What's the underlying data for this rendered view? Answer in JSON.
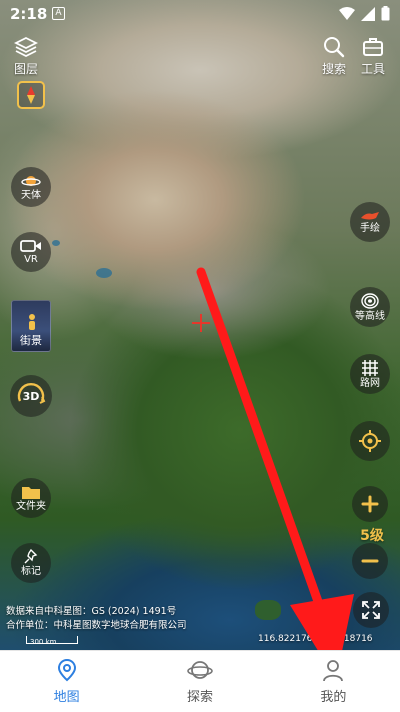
{
  "status_bar": {
    "time": "2:18",
    "notification": "A"
  },
  "top_left": {
    "layers_label": "图层"
  },
  "top_right": {
    "search_label": "搜索",
    "tools_label": "工具"
  },
  "left_tools": {
    "celestial_label": "天体",
    "vr_label": "VR",
    "street_label": "街景",
    "threed_label": "3D",
    "folder_label": "文件夹",
    "marker_label": "标记"
  },
  "right_tools": {
    "draw_label": "手绘",
    "contour_label": "等高线",
    "grid_label": "路网",
    "zoom_level": "5级"
  },
  "attribution": {
    "line1": "数据来自中科星图：GS (2024) 1491号",
    "line2": "合作单位：中科星图数字地球合肥有限公司"
  },
  "scale_label": "300 km",
  "coordinates": "116.82217634.66818716",
  "bottom_nav": {
    "map_label": "地图",
    "explore_label": "探索",
    "me_label": "我的"
  },
  "colors": {
    "accent": "#2d7fe0",
    "highlight": "#f2c14b",
    "arrow": "#ff1a1a"
  }
}
